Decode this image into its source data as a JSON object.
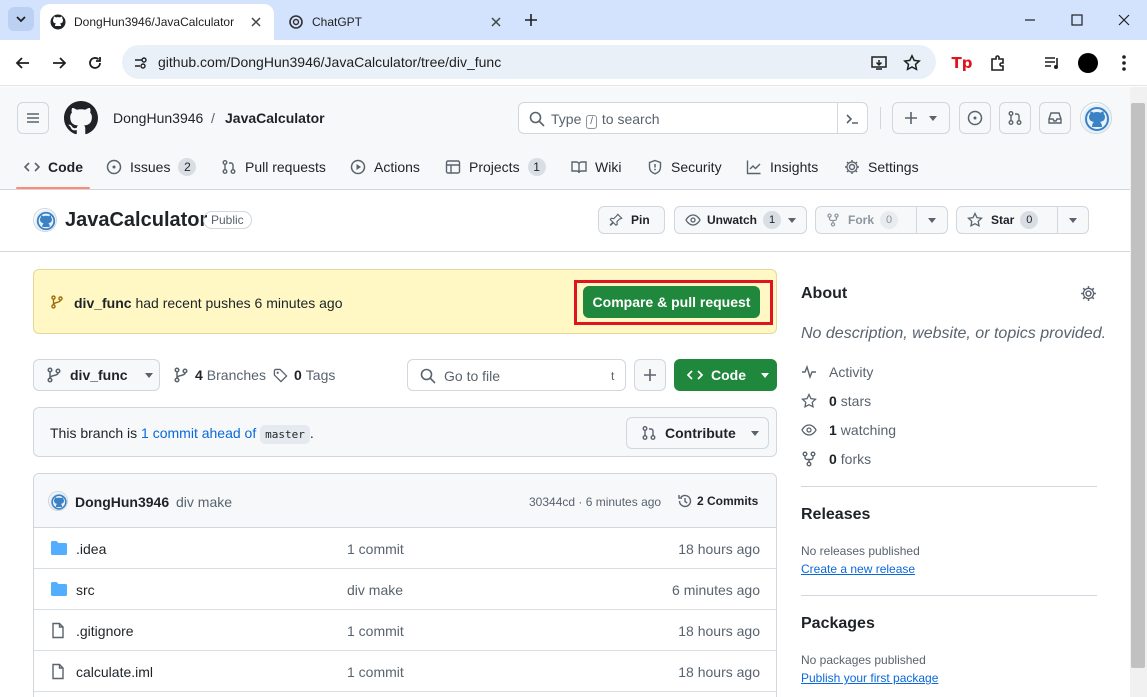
{
  "browser": {
    "tabs": [
      {
        "title": "DongHun3946/JavaCalculator",
        "active": true
      },
      {
        "title": "ChatGPT",
        "active": false
      }
    ],
    "url": "github.com/DongHun3946/JavaCalculator/tree/div_func"
  },
  "header": {
    "owner": "DongHun3946",
    "separator": "/",
    "repo": "JavaCalculator",
    "search_placeholder_pre": "Type",
    "search_placeholder_key": "/",
    "search_placeholder_post": "to search",
    "plus_label": "+"
  },
  "nav": [
    {
      "label": "Code",
      "count": null
    },
    {
      "label": "Issues",
      "count": "2"
    },
    {
      "label": "Pull requests",
      "count": null
    },
    {
      "label": "Actions",
      "count": null
    },
    {
      "label": "Projects",
      "count": "1"
    },
    {
      "label": "Wiki",
      "count": null
    },
    {
      "label": "Security",
      "count": null
    },
    {
      "label": "Insights",
      "count": null
    },
    {
      "label": "Settings",
      "count": null
    }
  ],
  "repo": {
    "name": "JavaCalculator",
    "visibility": "Public",
    "pin_label": "Pin",
    "unwatch_label": "Unwatch",
    "unwatch_count": "1",
    "fork_label": "Fork",
    "fork_count": "0",
    "star_label": "Star",
    "star_count": "0"
  },
  "banner": {
    "branch": "div_func",
    "text": "had recent pushes 6 minutes ago",
    "button": "Compare & pull request"
  },
  "filenav": {
    "branch": "div_func",
    "branches_count": "4",
    "branches_label": "Branches",
    "tags_count": "0",
    "tags_label": "Tags",
    "goto_placeholder": "Go to file",
    "goto_key": "t",
    "code_label": "Code"
  },
  "ahead": {
    "prefix": "This branch is",
    "link": "1 commit ahead of",
    "base": "master",
    "suffix": ".",
    "contribute": "Contribute"
  },
  "commit": {
    "author": "DongHun3946",
    "message": "div make",
    "sha_time": "30344cd · 6 minutes ago",
    "commits_label": "2 Commits"
  },
  "files": [
    {
      "type": "folder",
      "name": ".idea",
      "message": "1 commit",
      "age": "18 hours ago"
    },
    {
      "type": "folder",
      "name": "src",
      "message": "div make",
      "age": "6 minutes ago"
    },
    {
      "type": "file",
      "name": ".gitignore",
      "message": "1 commit",
      "age": "18 hours ago"
    },
    {
      "type": "file",
      "name": "calculate.iml",
      "message": "1 commit",
      "age": "18 hours ago"
    }
  ],
  "about": {
    "title": "About",
    "description": "No description, website, or topics provided.",
    "activity": "Activity",
    "stars_count": "0",
    "stars_label": "stars",
    "watching_count": "1",
    "watching_label": "watching",
    "forks_count": "0",
    "forks_label": "forks"
  },
  "releases": {
    "title": "Releases",
    "none": "No releases published",
    "create": "Create a new release"
  },
  "packages": {
    "title": "Packages",
    "none": "No packages published",
    "publish": "Publish your first package"
  },
  "colors": {
    "accent_green": "#1f883d",
    "highlight_red": "#e0141e",
    "banner_yellow": "#fff8c5",
    "link_blue": "#0969da"
  }
}
